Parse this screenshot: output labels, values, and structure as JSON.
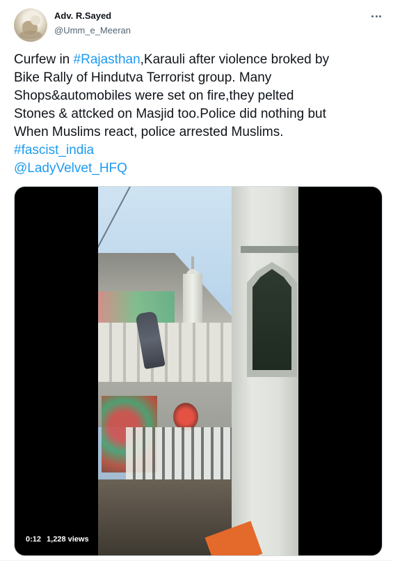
{
  "author": {
    "display_name": "Adv. R.Sayed",
    "handle": "@Umm_e_Meeran"
  },
  "tweet": {
    "line1_prefix": "Curfew in ",
    "line1_hashtag": "#Rajasthan",
    "line1_suffix": ",Karauli after violence broked by",
    "line2": "Bike Rally of Hindutva Terrorist group. Many",
    "line3": "Shops&automobiles were set on fire,they pelted",
    "line4": "Stones & attcked on Masjid too.Police did nothing but",
    "line5": "When Muslims react, police arrested Muslims.",
    "hashtag2": "#fascist_india",
    "mention": "@LadyVelvet_HFQ"
  },
  "video": {
    "elapsed": "0:12",
    "views": "1,228 views"
  },
  "icons": {
    "more": "more-options-icon",
    "avatar": "avatar"
  },
  "colors": {
    "link": "#1d9bf0",
    "text": "#0f1419",
    "secondary": "#536471"
  }
}
